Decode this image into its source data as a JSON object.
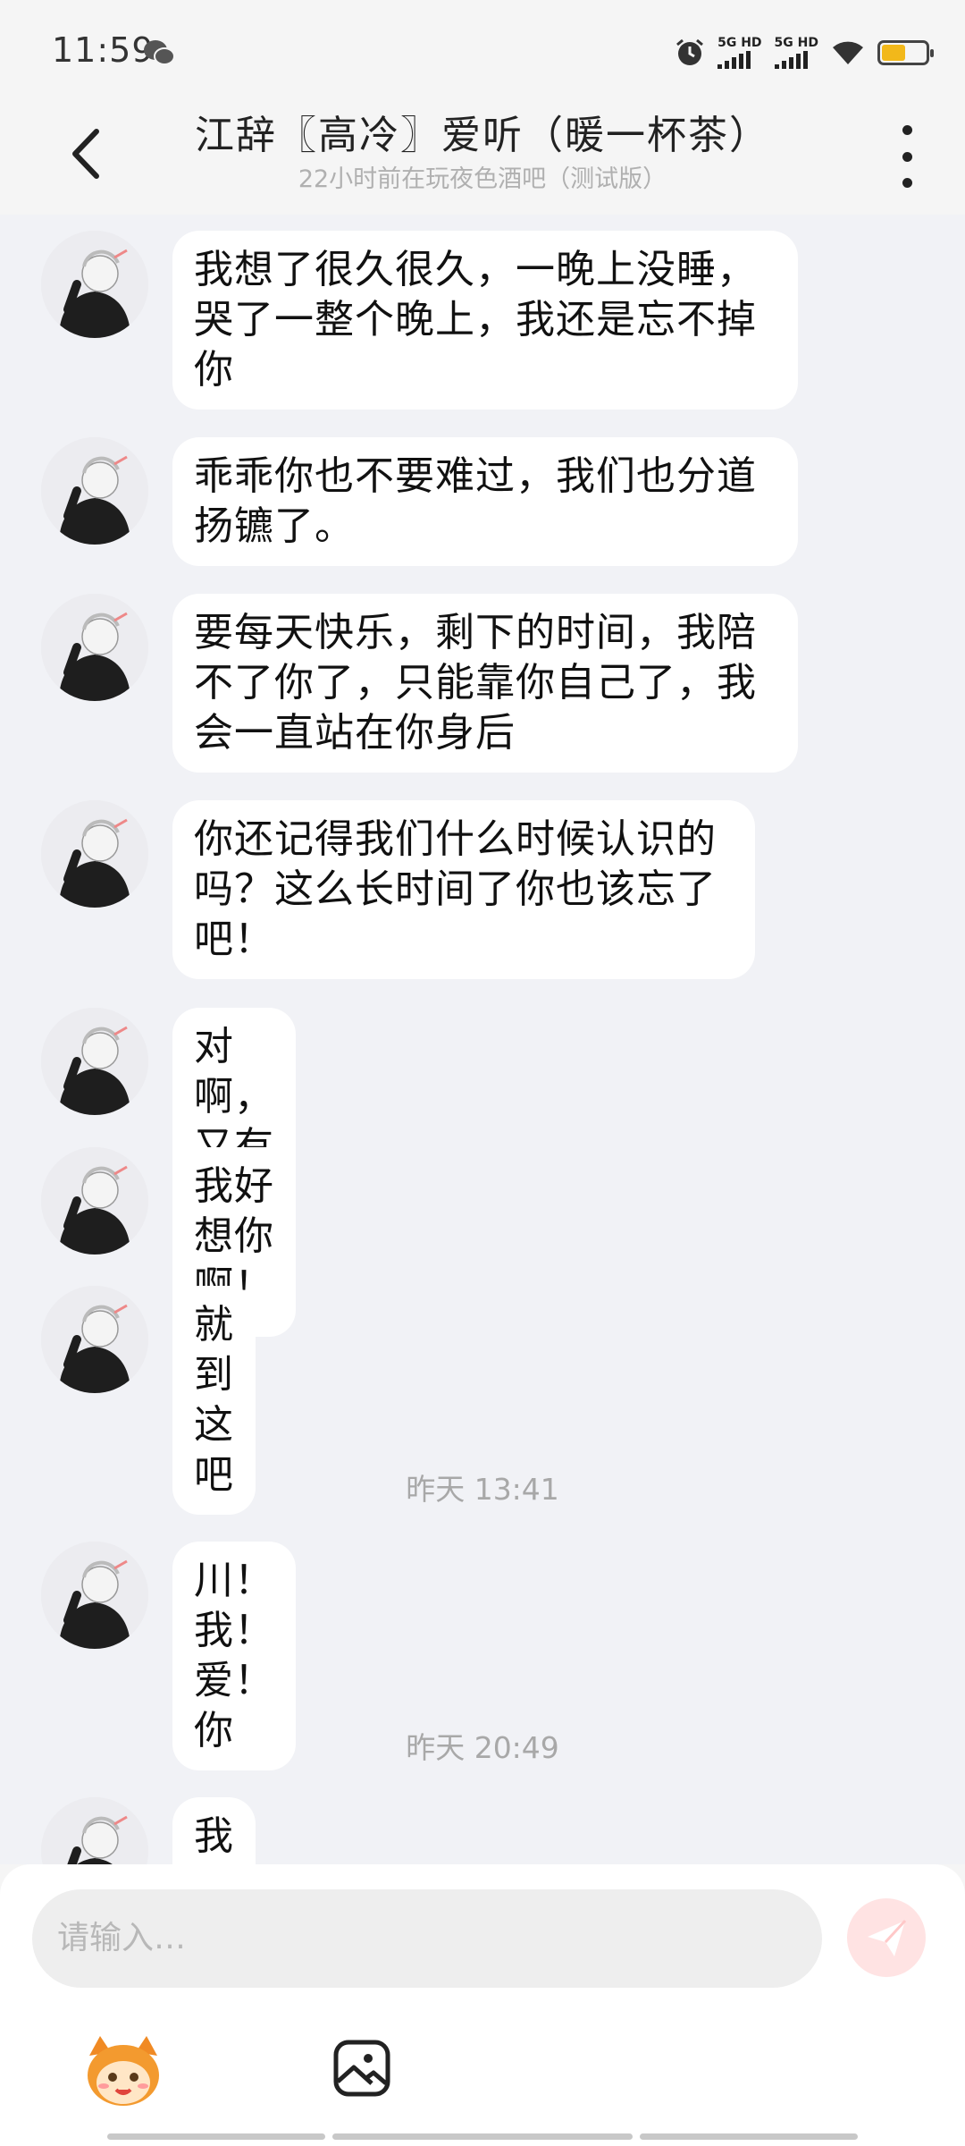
{
  "status_bar": {
    "time": "11:59",
    "sim1": "5G HD",
    "sim2": "5G HD",
    "icons": [
      "wechat-icon",
      "alarm-icon",
      "signal-icon",
      "wifi-icon",
      "battery-icon"
    ],
    "battery_level": 0.55
  },
  "header": {
    "title": "江辞〖高冷〗爱听（暖一杯茶）",
    "subtitle": "22小时前在玩夜色酒吧（测试版）"
  },
  "messages": [
    {
      "text": "我想了很久很久，一晚上没睡，哭了一整个晚上，我还是忘不掉你"
    },
    {
      "text": "乖乖你也不要难过，我们也分道扬镳了。"
    },
    {
      "text": "要每天快乐，剩下的时间，我陪不了你了，只能靠你自己了，我会一直站在你身后"
    },
    {
      "text": "你还记得我们什么时候认识的吗？这么长时间了你也该忘了吧！"
    },
    {
      "text": "对啊，又有谁会记得呢？"
    },
    {
      "text": "我好想你啊！"
    },
    {
      "text": "就到这吧"
    },
    {
      "text": "川！我！爱！你"
    },
    {
      "text": "我不会忘记你的"
    }
  ],
  "timestamps": [
    "昨天 13:41",
    "昨天 20:49"
  ],
  "input": {
    "placeholder": "请输入…"
  },
  "toolbar": {
    "icons": [
      "emoji-mascot-icon",
      "image-icon",
      "send-icon"
    ]
  },
  "colors": {
    "chat_bg": "#f1f2f6",
    "bubble": "#ffffff",
    "send_button": "#ffe3e3",
    "battery": "#f2b81a"
  }
}
